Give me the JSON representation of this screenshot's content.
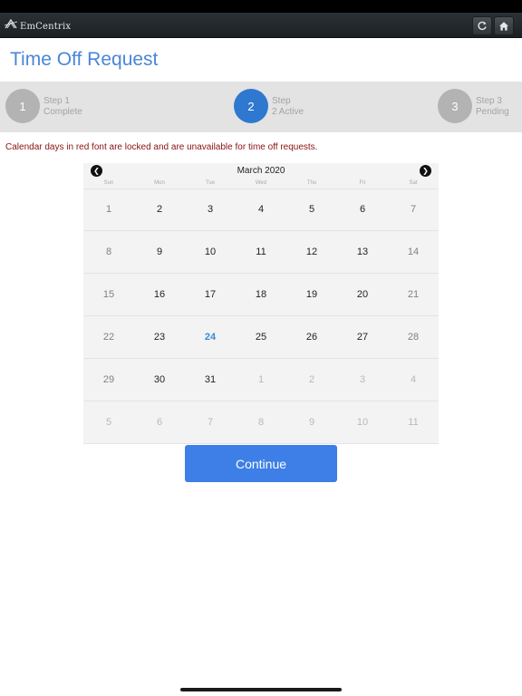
{
  "app": {
    "brand": "EmCentrix",
    "title": "Time Off Request",
    "icons": {
      "logo": "emcentrix-logo-icon",
      "refresh": "refresh-icon",
      "home": "home-icon"
    }
  },
  "steps": [
    {
      "number": "1",
      "name": "Step 1",
      "status": "Complete"
    },
    {
      "number": "2",
      "name": "Step",
      "status": "2 Active"
    },
    {
      "number": "3",
      "name": "Step 3",
      "status": "Pending"
    }
  ],
  "notice": "Calendar days in red font are locked and are unavailable for time off requests.",
  "calendar": {
    "month_label": "March 2020",
    "prev_icon": "chevron-left-icon",
    "next_icon": "chevron-right-icon",
    "weekdays": [
      "Sun",
      "Mon",
      "Tue",
      "Wed",
      "Thu",
      "Fri",
      "Sat"
    ],
    "weeks": [
      [
        "1",
        "2",
        "3",
        "4",
        "5",
        "6",
        "7"
      ],
      [
        "8",
        "9",
        "10",
        "11",
        "12",
        "13",
        "14"
      ],
      [
        "15",
        "16",
        "17",
        "18",
        "19",
        "20",
        "21"
      ],
      [
        "22",
        "23",
        "24",
        "25",
        "26",
        "27",
        "28"
      ],
      [
        "29",
        "30",
        "31",
        "1",
        "2",
        "3",
        "4"
      ],
      [
        "5",
        "6",
        "7",
        "8",
        "9",
        "10",
        "11"
      ]
    ],
    "today": "24",
    "other_month_from": {
      "week": 4,
      "day": 3
    }
  },
  "actions": {
    "continue_label": "Continue"
  },
  "colors": {
    "accent": "#3d7fe6",
    "title": "#4a86d8",
    "step_active": "#2e78d0",
    "step_inactive": "#b3b3b3",
    "notice": "#8b1111",
    "today": "#3a8ad8"
  }
}
